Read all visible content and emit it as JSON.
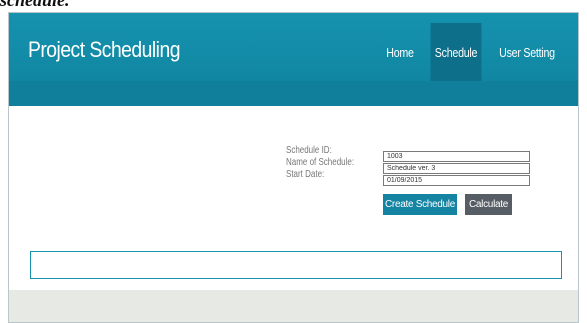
{
  "caption": "schedule.",
  "app": {
    "title": "Project Scheduling"
  },
  "nav": {
    "items": [
      {
        "label": "Home"
      },
      {
        "label": "Schedule",
        "active": true
      },
      {
        "label": "User Setting"
      }
    ]
  },
  "form": {
    "fields": [
      {
        "label": "Schedule ID:",
        "value": "1003"
      },
      {
        "label": "Name of Schedule:",
        "value": "Schedule ver. 3"
      },
      {
        "label": "Start Date:",
        "value": "01/09/2015"
      }
    ],
    "create_label": "Create Schedule",
    "calculate_label": "Calculate"
  },
  "colors": {
    "header": "#1592ae",
    "active_tab": "#0d6f89",
    "primary_button": "#1584a3",
    "secondary_button": "#575d64",
    "footer": "#e6e9e4"
  }
}
